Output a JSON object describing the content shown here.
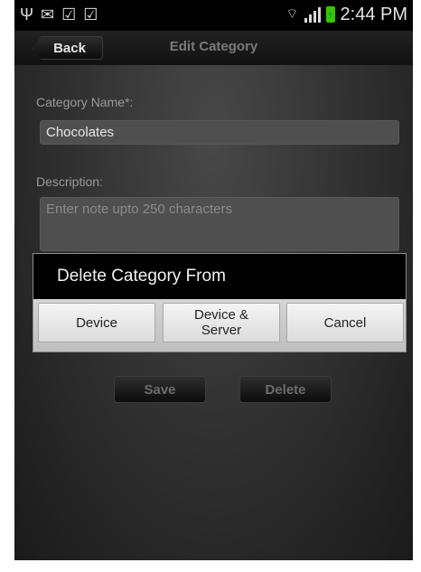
{
  "status_bar": {
    "icons_left": [
      "usb-icon",
      "mail-icon",
      "bag-check-icon",
      "bag-check-icon"
    ],
    "icons_right": [
      "wifi-icon",
      "signal-icon",
      "battery-charging-icon"
    ],
    "time": "2:44 PM",
    "battery_color": "#37c300"
  },
  "header": {
    "back_label": "Back",
    "title": "Edit Category"
  },
  "form": {
    "name_label": "Category Name*:",
    "name_value": "Chocolates",
    "description_label": "Description:",
    "description_placeholder": "Enter note upto 250 characters"
  },
  "actions": {
    "save_label": "Save",
    "delete_label": "Delete"
  },
  "dialog": {
    "title": "Delete Category From",
    "buttons": [
      {
        "label": "Device"
      },
      {
        "label": "Device & Server"
      },
      {
        "label": "Cancel"
      }
    ]
  }
}
